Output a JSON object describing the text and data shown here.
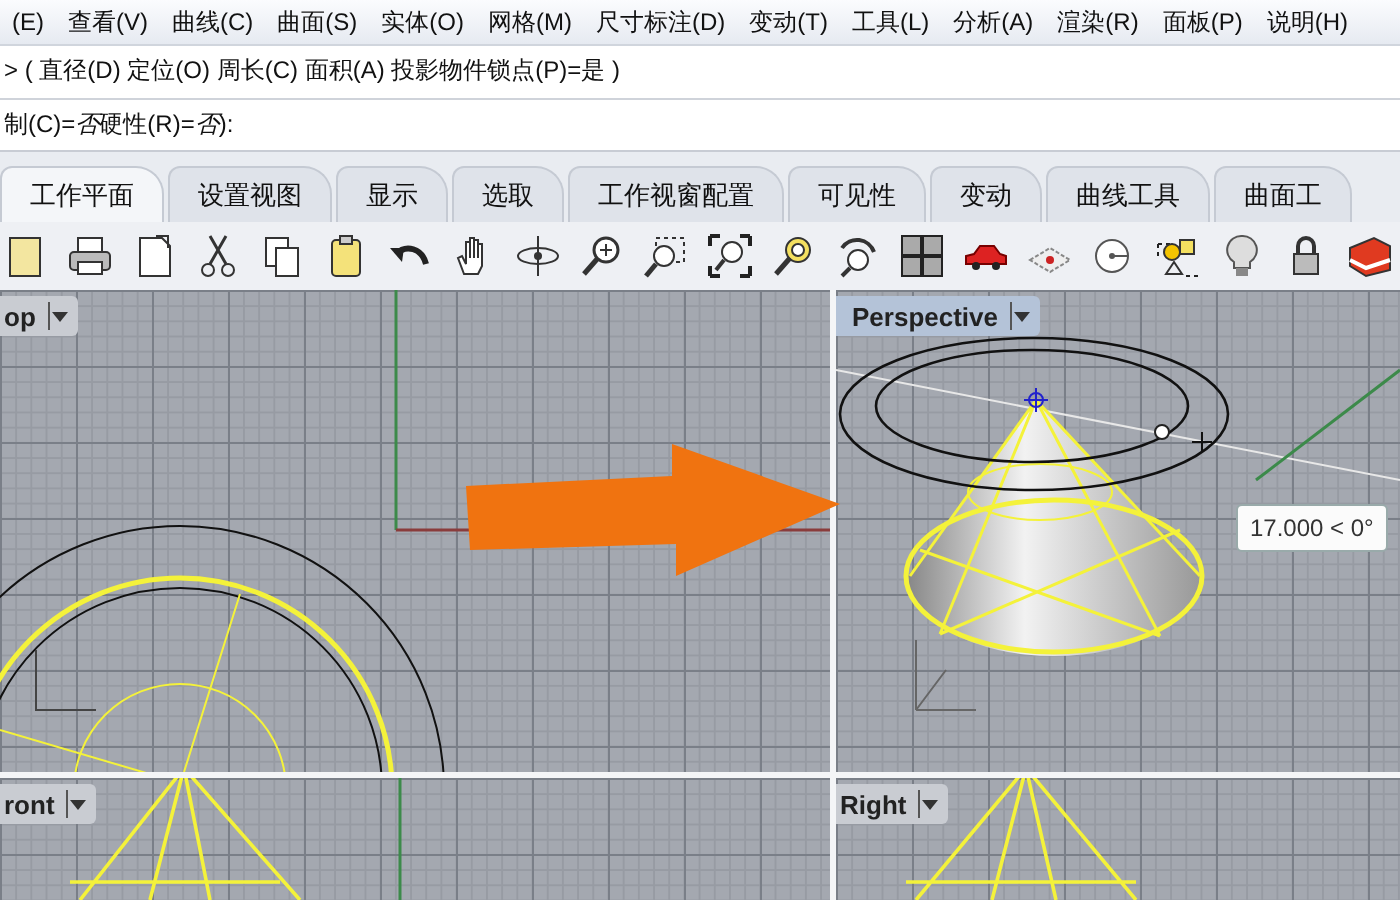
{
  "menu": [
    "(E)",
    "查看(V)",
    "曲线(C)",
    "曲面(S)",
    "实体(O)",
    "网格(M)",
    "尺寸标注(D)",
    "变动(T)",
    "工具(L)",
    "分析(A)",
    "渲染(R)",
    "面板(P)",
    "说明(H)"
  ],
  "command_history": "> ( 直径(D)  定位(O)  周长(C)  面积(A)  投影物件锁点(P)=是 )",
  "command_prompt": "制(C)=*否*  硬性(R)=*否*):",
  "tabs": [
    {
      "label": "工作平面",
      "selected": true
    },
    {
      "label": "设置视图",
      "selected": false
    },
    {
      "label": "显示",
      "selected": false
    },
    {
      "label": "选取",
      "selected": false
    },
    {
      "label": "工作视窗配置",
      "selected": false
    },
    {
      "label": "可见性",
      "selected": false
    },
    {
      "label": "变动",
      "selected": false
    },
    {
      "label": "曲线工具",
      "selected": false
    },
    {
      "label": "曲面工",
      "selected": false
    }
  ],
  "viewports": [
    {
      "kind": "top",
      "title": "op",
      "active": false
    },
    {
      "kind": "perspective",
      "title": "Perspective",
      "active": true
    },
    {
      "kind": "front",
      "title": "ront",
      "active": false
    },
    {
      "kind": "right",
      "title": "Right",
      "active": false
    }
  ],
  "tooltip": "17.000 < 0°"
}
